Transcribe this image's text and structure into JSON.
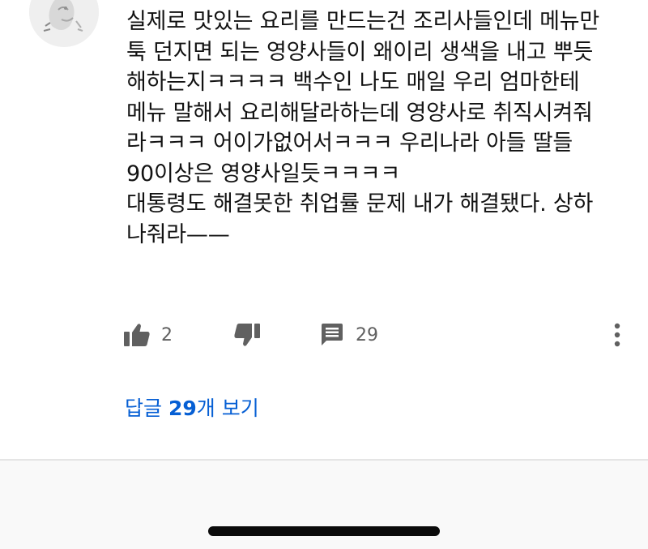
{
  "comment": {
    "text": "실제로 맛있는 요리를 만드는건 조리사들인데 메뉴만\n툭 던지면 되는 영양사들이 왜이리 생색을 내고 뿌듯\n해하는지ㅋㅋㅋㅋ 백수인 나도 매일 우리 엄마한테\n메뉴 말해서 요리해달라하는데 영양사로 취직시켜줘\n라ㅋㅋㅋ 어이가없어서ㅋㅋㅋ  우리나라 아들 딸들\n90이상은 영양사일듯ㅋㅋㅋㅋ\n대통령도 해결못한 취업률 문제 내가 해결됐다. 상하\n나줘라——",
    "like_count": "2",
    "reply_count": "29",
    "view_replies": {
      "prefix": "답글 ",
      "count": "29",
      "suffix": "개 보기"
    }
  },
  "icons": {
    "like": "thumbs-up-icon",
    "dislike": "thumbs-down-icon",
    "reply": "comment-icon",
    "more": "more-vertical-icon",
    "avatar": "avatar-image"
  },
  "colors": {
    "link": "#065fd4",
    "text": "#0f0f0f",
    "secondary_text": "#606060",
    "icon": "#606060",
    "divider": "#e5e5e5",
    "home_indicator": "#0b0b0b"
  }
}
